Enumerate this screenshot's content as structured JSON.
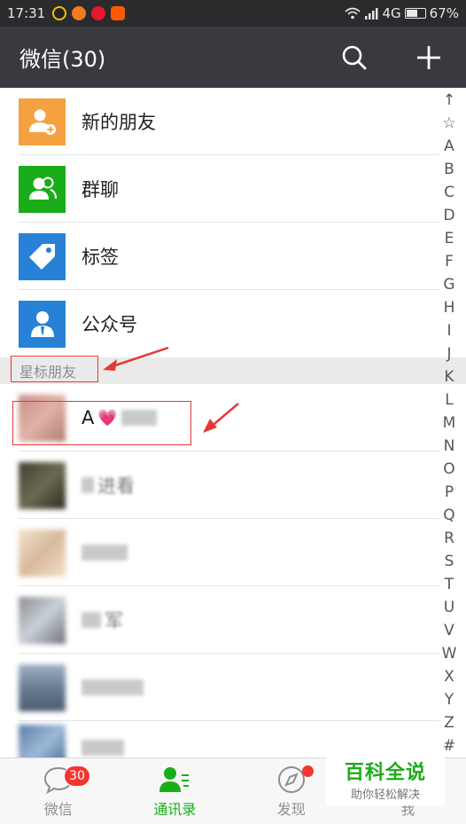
{
  "status_bar": {
    "time": "17:31",
    "network": "4G",
    "battery": "67%",
    "battery_level": 0.67
  },
  "header": {
    "title": "微信(30)",
    "search_icon": "search-icon",
    "add_icon": "plus-icon"
  },
  "fixed_entries": [
    {
      "label": "新的朋友",
      "icon": "add-friend-icon",
      "color": "#f5a142"
    },
    {
      "label": "群聊",
      "icon": "group-chat-icon",
      "color": "#1aad19"
    },
    {
      "label": "标签",
      "icon": "tag-icon",
      "color": "#2782d7"
    },
    {
      "label": "公众号",
      "icon": "official-account-icon",
      "color": "#2782d7"
    }
  ],
  "starred_section": {
    "label": "星标朋友"
  },
  "contacts": [
    {
      "name_visible": "A",
      "emoji": "💗"
    },
    {
      "name_visible": "进看"
    },
    {
      "name_visible": ""
    },
    {
      "name_visible": "军"
    },
    {
      "name_visible": ""
    },
    {
      "name_visible": ""
    }
  ],
  "alphabet_index": [
    "↑",
    "☆",
    "A",
    "B",
    "C",
    "D",
    "E",
    "F",
    "G",
    "H",
    "I",
    "J",
    "K",
    "L",
    "M",
    "N",
    "O",
    "P",
    "Q",
    "R",
    "S",
    "T",
    "U",
    "V",
    "W",
    "X",
    "Y",
    "Z",
    "#"
  ],
  "bottom_nav": [
    {
      "label": "微信",
      "icon": "chat-icon",
      "badge": "30"
    },
    {
      "label": "通讯录",
      "icon": "contacts-icon",
      "active": true
    },
    {
      "label": "发现",
      "icon": "compass-icon",
      "dot": true
    },
    {
      "label": "我",
      "icon": "me-icon"
    }
  ],
  "watermark": {
    "line1": "百科全说",
    "line2": "助你轻松解决"
  },
  "colors": {
    "accent": "#1aad19",
    "header_bg": "#393a3f",
    "badge": "#f43530",
    "highlight_box": "#e53935"
  }
}
